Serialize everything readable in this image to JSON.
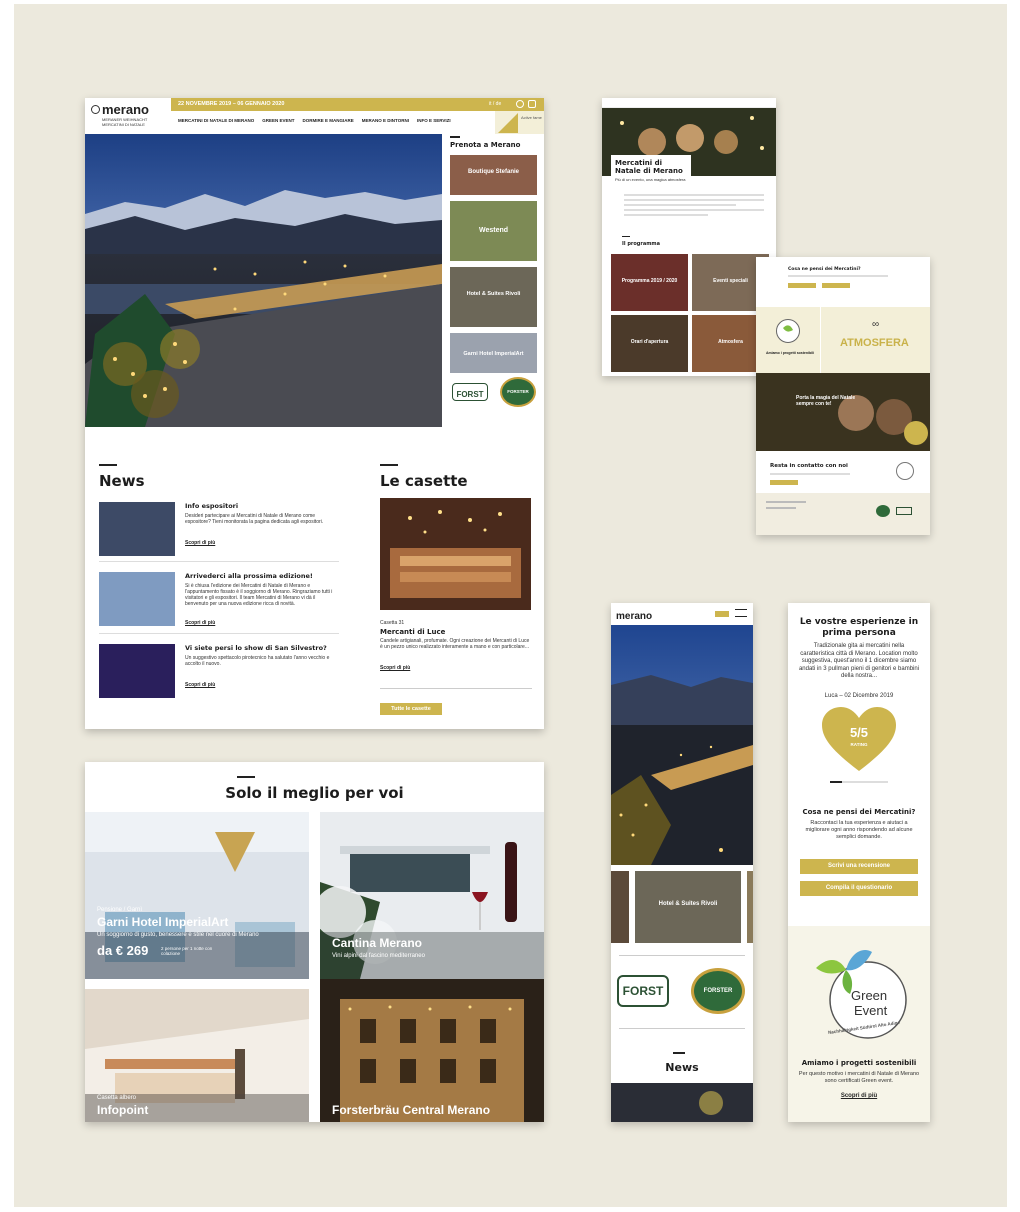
{
  "desktop": {
    "logo": "merano",
    "logo_sub1": "MERANER WEIHNACHT",
    "logo_sub2": "MERCATINI DI NATALE",
    "dates": "22 NOVEMBRE 2019 – 06 GENNAIO 2020",
    "lang": "it / de",
    "nav": [
      "MERCATINI DI NATALE DI MERANO",
      "GREEN EVENT",
      "DORMIRE E MANGIARE",
      "MERANO E DINTORNI",
      "INFO E SERVIZI"
    ],
    "corner_text": "Active fame",
    "sidebar_title": "Prenota a Merano",
    "hotels": [
      "Boutique Stefanie",
      "Westend",
      "Hotel & Suites Rivoli",
      "Garni Hotel ImperialArt"
    ],
    "news_title": "News",
    "news": [
      {
        "title": "Info espositori",
        "text": "Desideri partecipare ai Mercatini di Natale di Merano come espositore? Tieni monitorata la pagina dedicata agli espositori.",
        "link": "Scopri di più"
      },
      {
        "title": "Arrivederci alla prossima edizione!",
        "text": "Si è chiusa l'edizione dei Mercatini di Natale di Merano e l'appuntamento fissato è il soggiorno di Merano. Ringraziamo tutti i visitatori e gli espositori. Il team Mercatini di Merano vi dà il benvenuto per una nuova edizione ricca di novità.",
        "link": "Scopri di più"
      },
      {
        "title": "Vi siete persi lo show di San Silvestro?",
        "text": "Un suggestivo spettacolo pirotecnico ha salutato l'anno vecchio e accolto il nuovo.",
        "link": "Scopri di più"
      }
    ],
    "casette_title": "Le casette",
    "casetta_num": "Casetta 31",
    "casetta_name": "Mercanti di Luce",
    "casetta_text": "Candele artigianali, profumate. Ogni creazione dei Mercanti di Luce è un pezzo unico realizzato interamente a mano e con particolare...",
    "casetta_link": "Scopri di più",
    "casette_button": "Tutte le casette",
    "sponsor1": "FORST",
    "sponsor2": "FORSTER"
  },
  "best": {
    "title": "Solo il meglio per voi",
    "hotel_tag": "Pensione / Garnì",
    "hotel_name": "Garni Hotel ImperialArt",
    "hotel_desc": "Un soggiorno di gusto, benessere e stile nel cuore di Merano",
    "hotel_price": "da € 269",
    "hotel_price_note": "2 persone per 1 notte con colazione",
    "cantina_name": "Cantina Merano",
    "cantina_desc": "Vini alpini dal fascino mediterraneo",
    "info_tag": "Casetta albero",
    "info_name": "Infopoint",
    "forst_name": "Forsterbräu Central Merano"
  },
  "page2": {
    "title": "Mercatini di Natale di Merano",
    "subtitle": "Più di un evento, una magica atmosfera",
    "program": "Il programma",
    "tiles": [
      "Programma 2019 / 2020",
      "Eventi speciali",
      "Orari d'apertura",
      "Atmosfera"
    ]
  },
  "page3": {
    "q": "Cosa ne pensi dei Mercatini?",
    "atmosfera": "ATMOSFERA",
    "green": "Green Event",
    "green_sub": "Amiamo i progetti sostenibili",
    "promo": "Porta la magia del Natale sempre con te!",
    "contact": "Resta in contatto con noi"
  },
  "mobile": {
    "logo": "merano",
    "hotel": "Hotel & Suites Rivoli",
    "news": "News"
  },
  "review": {
    "title": "Le vostre esperienze in prima persona",
    "text": "Tradizionale gita ai mercatini nella caratteristica città di Merano. Location molto suggestiva, quest'anno il 1 dicembre siamo andati in 3 pullman pieni di genitori e bambini della nostra...",
    "author": "Luca – 02 Dicembre 2019",
    "rating": "5/5",
    "rating_label": "RATING",
    "q": "Cosa ne pensi dei Mercatini?",
    "q_text": "Raccontaci la tua esperienza e aiutaci a migliorare ogni anno rispondendo ad alcune semplici domande.",
    "btn1": "Scrivi una recensione",
    "btn2": "Compila il questionario",
    "badge1": "Green",
    "badge2": "Event",
    "badge_ring": "Nachhaltigkeit Südtirol Alto Adige",
    "green_title": "Amiamo i progetti sostenibili",
    "green_text": "Per questo motivo i mercatini di Natale di Merano sono certificati Green event.",
    "green_link": "Scopri di più"
  }
}
